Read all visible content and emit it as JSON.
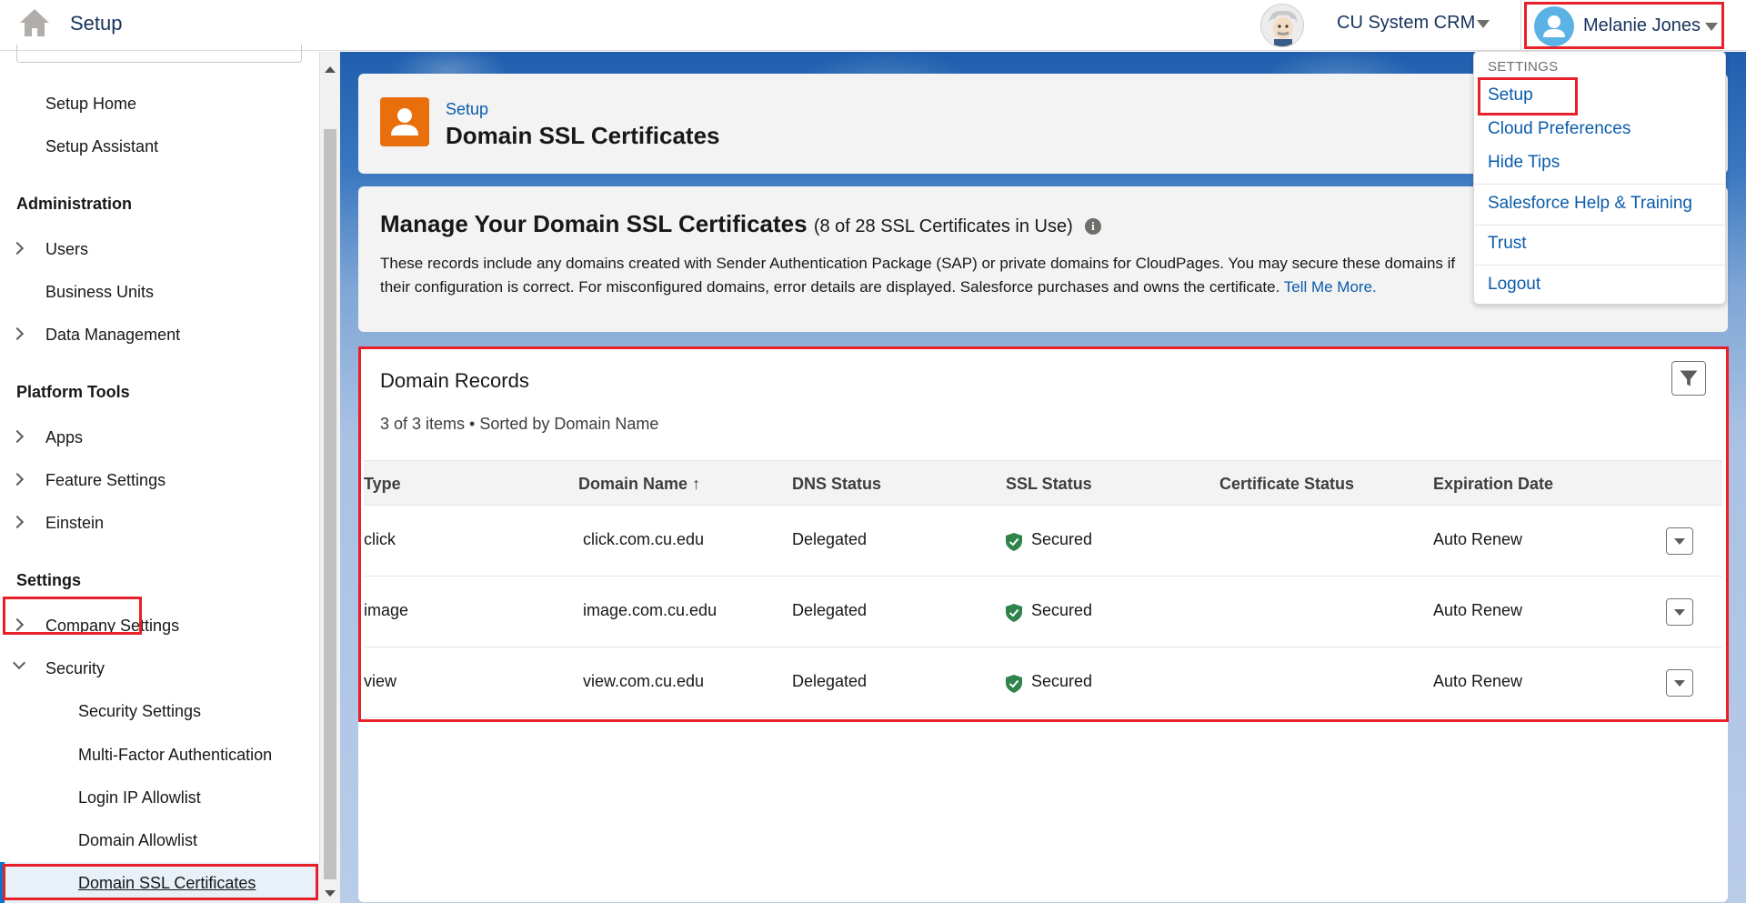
{
  "header": {
    "app_title": "Setup",
    "org_name": "CU System CRM",
    "user_name": "Melanie Jones",
    "icons": {
      "home": "home-icon",
      "org_avatar": "einstein-avatar-icon",
      "user_avatar": "user-avatar-icon"
    }
  },
  "sidebar": {
    "items": {
      "setup_home": "Setup Home",
      "setup_assistant": "Setup Assistant",
      "administration": "Administration",
      "users": "Users",
      "business_units": "Business Units",
      "data_management": "Data Management",
      "platform_tools": "Platform Tools",
      "apps": "Apps",
      "feature_settings": "Feature Settings",
      "einstein": "Einstein",
      "settings": "Settings",
      "company_settings": "Company Settings",
      "security": "Security",
      "security_settings": "Security Settings",
      "mfa": "Multi-Factor Authentication",
      "login_ip_allowlist": "Login IP Allowlist",
      "domain_allowlist": "Domain Allowlist",
      "domain_ssl_certificates": "Domain SSL Certificates"
    }
  },
  "page_header": {
    "breadcrumb": "Setup",
    "title": "Domain SSL Certificates"
  },
  "info": {
    "title": "Manage Your Domain SSL Certificates",
    "count": "(8 of 28 SSL Certificates in Use)",
    "info_icon": "i",
    "description": "These records include any domains created with Sender Authentication Package (SAP) or private domains for CloudPages. You may secure these domains if their configuration is correct. For misconfigured domains, error details are displayed. Salesforce purchases and owns the certificate.",
    "link": "Tell Me More."
  },
  "records": {
    "title": "Domain Records",
    "meta": "3 of 3 items  •  Sorted by Domain Name",
    "columns": [
      "Type",
      "Domain Name",
      "DNS Status",
      "SSL Status",
      "Certificate Status",
      "Expiration Date"
    ],
    "sort_arrow": "↑",
    "rows": [
      {
        "type": "click",
        "domain": "click.com.cu.edu",
        "dns": "Delegated",
        "ssl": "Secured",
        "cert": "",
        "expiration": "Auto Renew"
      },
      {
        "type": "image",
        "domain": "image.com.cu.edu",
        "dns": "Delegated",
        "ssl": "Secured",
        "cert": "",
        "expiration": "Auto Renew"
      },
      {
        "type": "view",
        "domain": "view.com.cu.edu",
        "dns": "Delegated",
        "ssl": "Secured",
        "cert": "",
        "expiration": "Auto Renew"
      }
    ]
  },
  "user_menu": {
    "section": "SETTINGS",
    "items": [
      "Setup",
      "Cloud Preferences",
      "Hide Tips",
      "Salesforce Help & Training",
      "Trust",
      "Logout"
    ]
  },
  "colors": {
    "accent": "#0b5cab",
    "highlight": "#e8202a",
    "secured": "#2e844a",
    "page_icon": "#e86f0c"
  }
}
